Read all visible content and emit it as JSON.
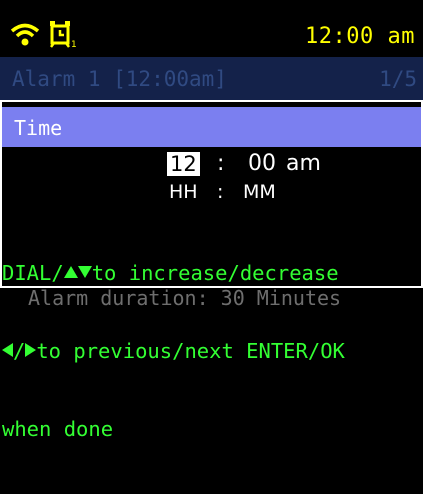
{
  "status_bar": {
    "time": "12:00 am",
    "alarm_number": "1",
    "icons": [
      "wifi-icon",
      "alarm-clock-icon"
    ]
  },
  "alarm_header": {
    "title": "Alarm 1 [12:00am]",
    "page": "1/5"
  },
  "dialog": {
    "title": "Time",
    "hour": "12",
    "colon": ":",
    "minute": "00",
    "ampm": "am",
    "format_hour": "HH",
    "format_colon": ":",
    "format_minute": "MM",
    "help_line1_prefix": "DIAL/",
    "help_line1_suffix": "to increase/decrease",
    "help_line2_slash": "/",
    "help_line2_suffix": "to previous/next ENTER/OK",
    "help_line3": "when done"
  },
  "footer": {
    "text": "Alarm duration: 30 Minutes"
  },
  "colors": {
    "accent_yellow": "#ffff00",
    "help_green": "#33ff33",
    "title_bar": "#7b7ff0",
    "header_bg": "#14224a"
  }
}
